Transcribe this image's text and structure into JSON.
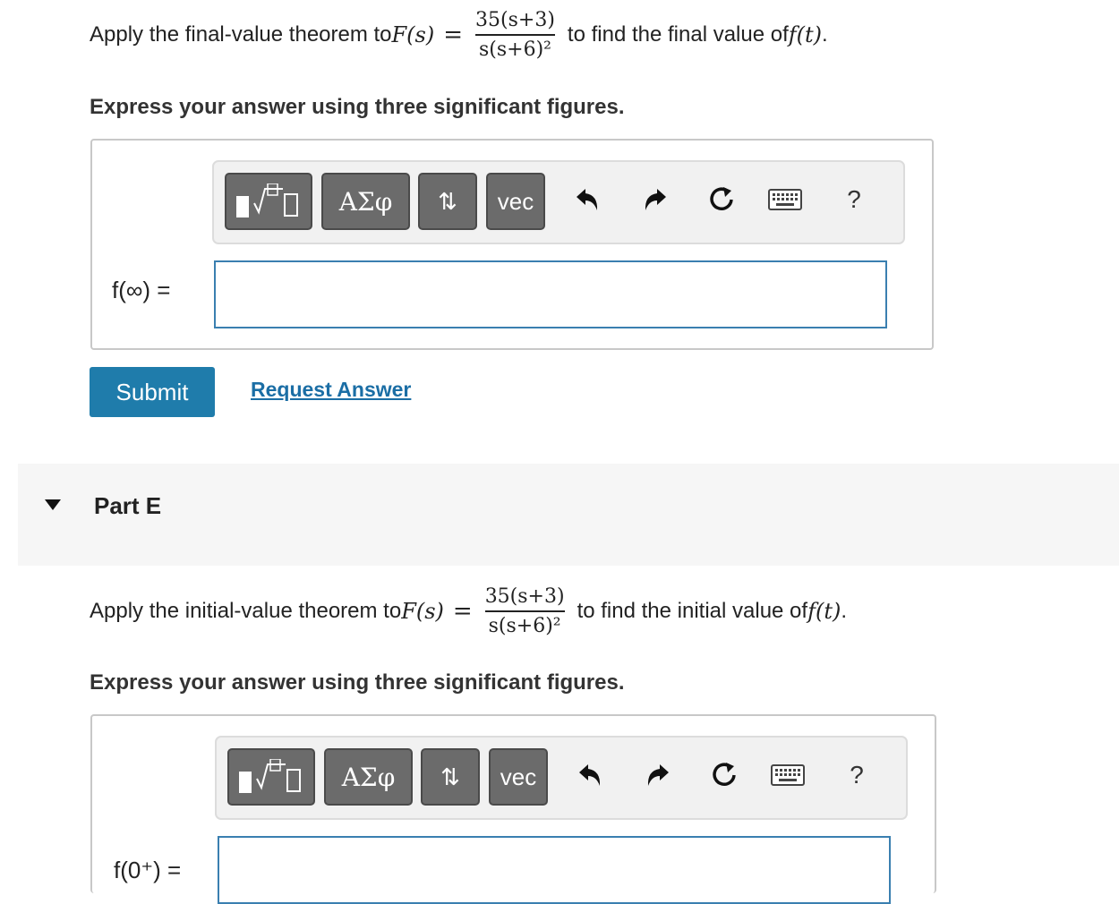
{
  "partD": {
    "problem": {
      "prefix": "Apply the final-value theorem to ",
      "func": "F(s)",
      "eq": "=",
      "numerator": "35(s+3)",
      "denominator": "s(s+6)²",
      "suffix": " to find the final value of ",
      "target": "f(t)",
      "end": "."
    },
    "instruction": "Express your answer using three significant figures.",
    "toolbar": {
      "vec": "vec",
      "greek": "ΑΣφ",
      "arrows": "⇅",
      "help": "?"
    },
    "input_label": "f(∞) =",
    "input_value": ""
  },
  "actions": {
    "submit": "Submit",
    "request_answer": "Request Answer"
  },
  "partE": {
    "title": "Part E",
    "problem": {
      "prefix": "Apply the initial-value theorem to ",
      "func": "F(s)",
      "eq": "=",
      "numerator": "35(s+3)",
      "denominator": "s(s+6)²",
      "suffix": " to find the initial value of ",
      "target": "f(t)",
      "end": "."
    },
    "instruction": "Express your answer using three significant figures.",
    "toolbar": {
      "vec": "vec",
      "greek": "ΑΣφ",
      "arrows": "⇅",
      "help": "?"
    },
    "input_label": "f(0⁺) =",
    "input_value": ""
  },
  "colors": {
    "accent": "#1f7cab",
    "link": "#1b6ea5",
    "input_border": "#3a7fb0",
    "toolbar_button": "#6b6b6b"
  }
}
